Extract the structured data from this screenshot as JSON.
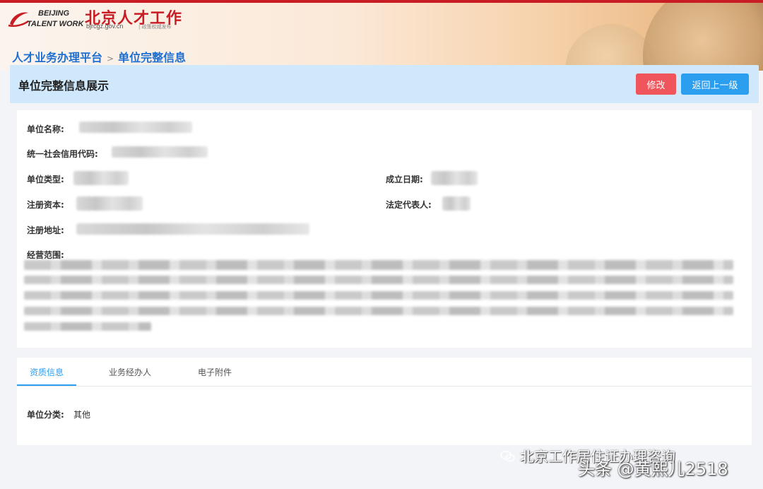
{
  "logo": {
    "line1": "BEIJING",
    "line2": "TALENT WORK",
    "cn_name": "北京人才工作",
    "url": "bjrcgz.gov.cn",
    "slogan": "| 政策权威发布"
  },
  "breadcrumb": {
    "root": "人才业务办理平台",
    "separator": ">",
    "current": "单位完整信息"
  },
  "panel": {
    "title": "单位完整信息展示",
    "edit_label": "修改",
    "back_label": "返回上一级"
  },
  "fields": {
    "unit_name": "单位名称:",
    "credit_code": "统一社会信用代码:",
    "unit_type": "单位类型:",
    "established": "成立日期:",
    "capital": "注册资本:",
    "legal_rep": "法定代表人:",
    "address": "注册地址:",
    "scope": "经营范围:"
  },
  "tabs": [
    {
      "label": "资质信息",
      "active": true
    },
    {
      "label": "业务经办人",
      "active": false
    },
    {
      "label": "电子附件",
      "active": false
    }
  ],
  "qualification": {
    "label": "单位分类:",
    "value": "其他"
  },
  "watermark": {
    "line1": "北京工作居住证办理咨询",
    "line2": "头条 @黄熙儿2518"
  },
  "colors": {
    "accent_blue": "#2b9ef0",
    "danger_red": "#f0555c",
    "header_bg": "#cfe8fb",
    "brand_red": "#c81d25",
    "breadcrumb_blue": "#1f6fd1"
  }
}
